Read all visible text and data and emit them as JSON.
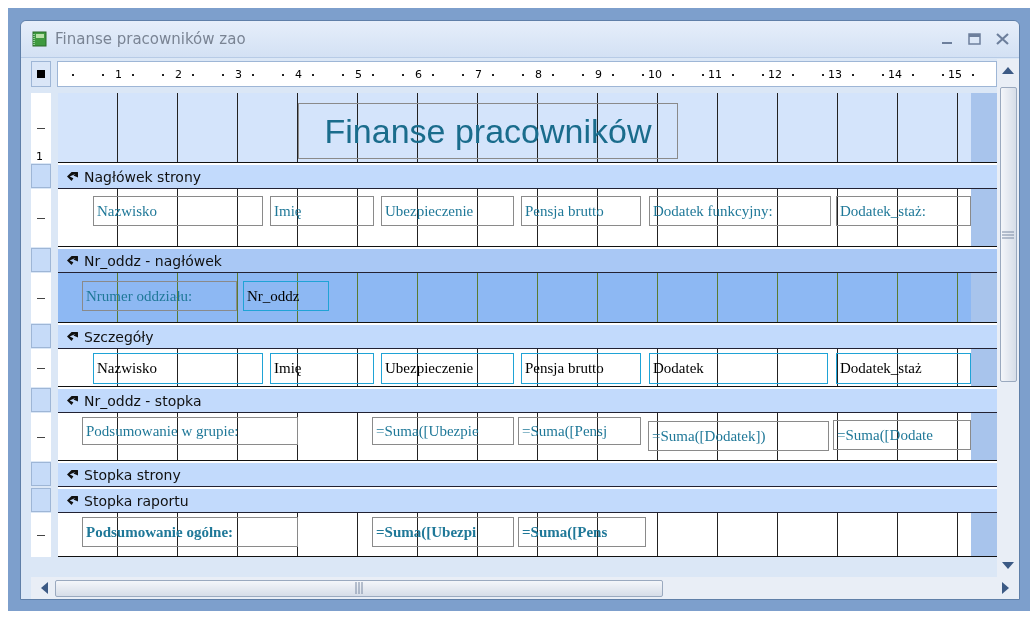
{
  "window": {
    "title": "Finanse pracowników zao"
  },
  "ruler": {
    "marks": [
      "1",
      "2",
      "3",
      "4",
      "5",
      "6",
      "7",
      "8",
      "9",
      "10",
      "11",
      "12",
      "13",
      "14",
      "15"
    ]
  },
  "sections": [
    {
      "selected": false,
      "ruler_label": "1",
      "controls": [
        {
          "kind": "title",
          "text": "Finanse pracowników"
        }
      ]
    },
    {
      "bar": "Nagłówek strony",
      "selected": false,
      "controls": [
        {
          "kind": "label",
          "text": "Nazwisko"
        },
        {
          "kind": "label",
          "text": "Imię"
        },
        {
          "kind": "label",
          "text": "Ubezpieczenie"
        },
        {
          "kind": "label",
          "text": "Pensja brutto"
        },
        {
          "kind": "label",
          "text": "Dodatek funkcyjny:"
        },
        {
          "kind": "label",
          "text": "Dodatek_staż:"
        }
      ]
    },
    {
      "bar": "Nr_oddz - nagłówek",
      "selected": true,
      "controls": [
        {
          "kind": "label",
          "text": "Nrumer oddziału:"
        },
        {
          "kind": "textbox",
          "text": "Nr_oddz"
        }
      ]
    },
    {
      "bar": "Szczegóły",
      "selected": false,
      "controls": [
        {
          "kind": "textbox",
          "text": "Nazwisko"
        },
        {
          "kind": "textbox",
          "text": "Imię"
        },
        {
          "kind": "textbox",
          "text": "Ubezpieczenie"
        },
        {
          "kind": "textbox",
          "text": "Pensja brutto"
        },
        {
          "kind": "textbox",
          "text": "Dodatek"
        },
        {
          "kind": "textbox",
          "text": "Dodatek_staż"
        }
      ]
    },
    {
      "bar": "Nr_oddz - stopka",
      "selected": false,
      "controls": [
        {
          "kind": "label",
          "text": "Podsumowanie w grupie:"
        },
        {
          "kind": "label",
          "text": "=Suma([Ubezpie"
        },
        {
          "kind": "label",
          "text": "=Suma([Pensj"
        },
        {
          "kind": "label",
          "text": "=Suma([Dodatek])"
        },
        {
          "kind": "label",
          "text": "=Suma([Dodate"
        }
      ]
    },
    {
      "bar": "Stopka strony",
      "selected": false
    },
    {
      "bar": "Stopka raportu",
      "selected": false,
      "controls": [
        {
          "kind": "label",
          "text": "Podsumowanie ogólne:",
          "bold": true
        },
        {
          "kind": "label",
          "text": "=Suma([Ubezpi",
          "bold": true
        },
        {
          "kind": "label",
          "text": "=Suma([Pens",
          "bold": true
        }
      ]
    }
  ]
}
